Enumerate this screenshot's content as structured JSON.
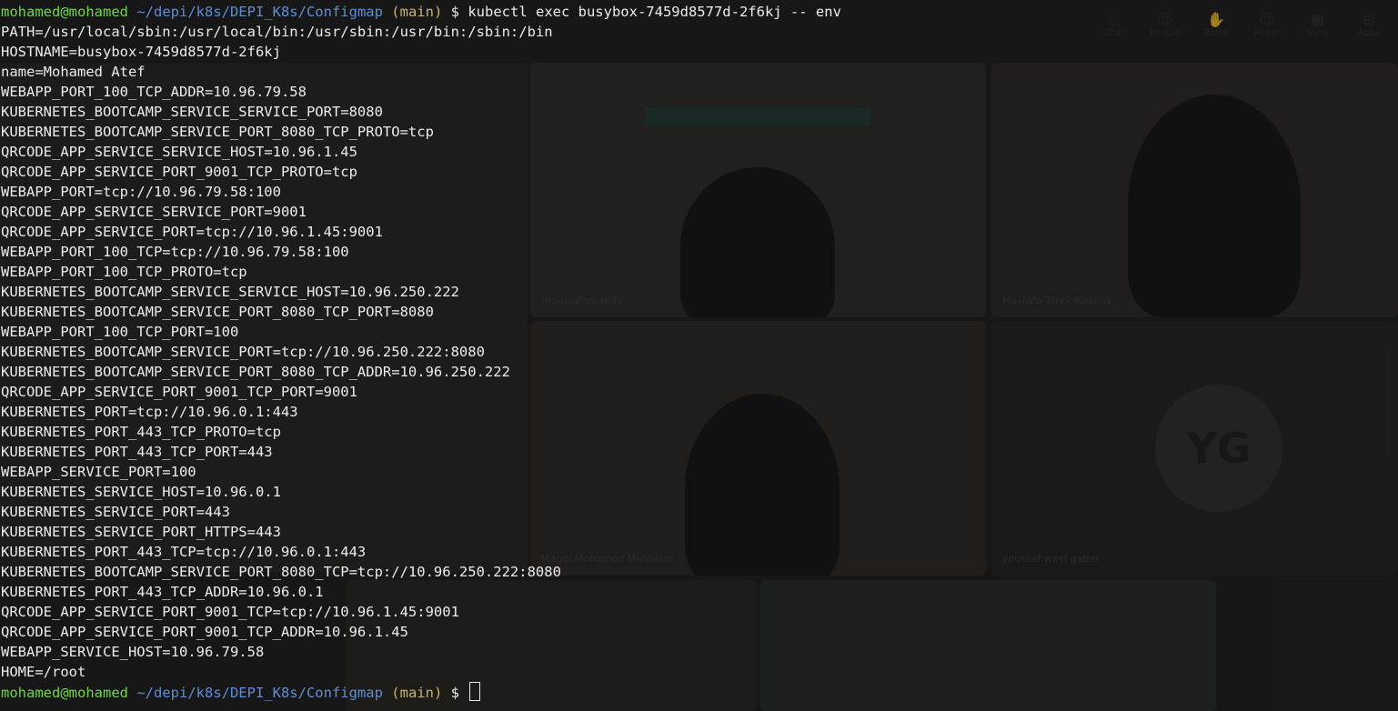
{
  "prompt": {
    "user": "mohamed@mohamed",
    "path": "~/depi/k8s/DEPI_K8s/Configmap",
    "branch": "(main)",
    "symbol": "$"
  },
  "command": "kubectl exec busybox-7459d8577d-2f6kj -- env",
  "output_lines": [
    "PATH=/usr/local/sbin:/usr/local/bin:/usr/sbin:/usr/bin:/sbin:/bin",
    "HOSTNAME=busybox-7459d8577d-2f6kj",
    "name=Mohamed Atef",
    "WEBAPP_PORT_100_TCP_ADDR=10.96.79.58",
    "KUBERNETES_BOOTCAMP_SERVICE_SERVICE_PORT=8080",
    "KUBERNETES_BOOTCAMP_SERVICE_PORT_8080_TCP_PROTO=tcp",
    "QRCODE_APP_SERVICE_SERVICE_HOST=10.96.1.45",
    "QRCODE_APP_SERVICE_PORT_9001_TCP_PROTO=tcp",
    "WEBAPP_PORT=tcp://10.96.79.58:100",
    "QRCODE_APP_SERVICE_SERVICE_PORT=9001",
    "QRCODE_APP_SERVICE_PORT=tcp://10.96.1.45:9001",
    "WEBAPP_PORT_100_TCP=tcp://10.96.79.58:100",
    "WEBAPP_PORT_100_TCP_PROTO=tcp",
    "KUBERNETES_BOOTCAMP_SERVICE_SERVICE_HOST=10.96.250.222",
    "KUBERNETES_BOOTCAMP_SERVICE_PORT_8080_TCP_PORT=8080",
    "WEBAPP_PORT_100_TCP_PORT=100",
    "KUBERNETES_BOOTCAMP_SERVICE_PORT=tcp://10.96.250.222:8080",
    "KUBERNETES_BOOTCAMP_SERVICE_PORT_8080_TCP_ADDR=10.96.250.222",
    "QRCODE_APP_SERVICE_PORT_9001_TCP_PORT=9001",
    "KUBERNETES_PORT=tcp://10.96.0.1:443",
    "KUBERNETES_PORT_443_TCP_PROTO=tcp",
    "KUBERNETES_PORT_443_TCP_PORT=443",
    "WEBAPP_SERVICE_PORT=100",
    "KUBERNETES_SERVICE_HOST=10.96.0.1",
    "KUBERNETES_SERVICE_PORT=443",
    "KUBERNETES_SERVICE_PORT_HTTPS=443",
    "KUBERNETES_PORT_443_TCP=tcp://10.96.0.1:443",
    "KUBERNETES_BOOTCAMP_SERVICE_PORT_8080_TCP=tcp://10.96.250.222:8080",
    "KUBERNETES_PORT_443_TCP_ADDR=10.96.0.1",
    "QRCODE_APP_SERVICE_PORT_9001_TCP=tcp://10.96.1.45:9001",
    "QRCODE_APP_SERVICE_PORT_9001_TCP_ADDR=10.96.1.45",
    "WEBAPP_SERVICE_HOST=10.96.79.58",
    "HOME=/root"
  ],
  "background": {
    "toolbar": [
      {
        "label": "Chat",
        "icon": "chat-icon"
      },
      {
        "label": "People",
        "icon": "people-icon"
      },
      {
        "label": "Raise",
        "icon": "hand-icon"
      },
      {
        "label": "React",
        "icon": "smile-icon"
      },
      {
        "label": "View",
        "icon": "grid-icon"
      },
      {
        "label": "Apps",
        "icon": "plus-icon"
      }
    ],
    "tiles": {
      "tile1_name": "moustafamandy",
      "tile2_name": "Mostafa Tarek Khamis",
      "tile3_name": "Magdi Mohamed Montaser",
      "tile4_name": "youssef wael gaber",
      "tile4_initials": "YG"
    }
  },
  "colors": {
    "user": "#6ed644",
    "path": "#5b8fd6",
    "branch": "#c9b26a",
    "text": "#ececec"
  }
}
